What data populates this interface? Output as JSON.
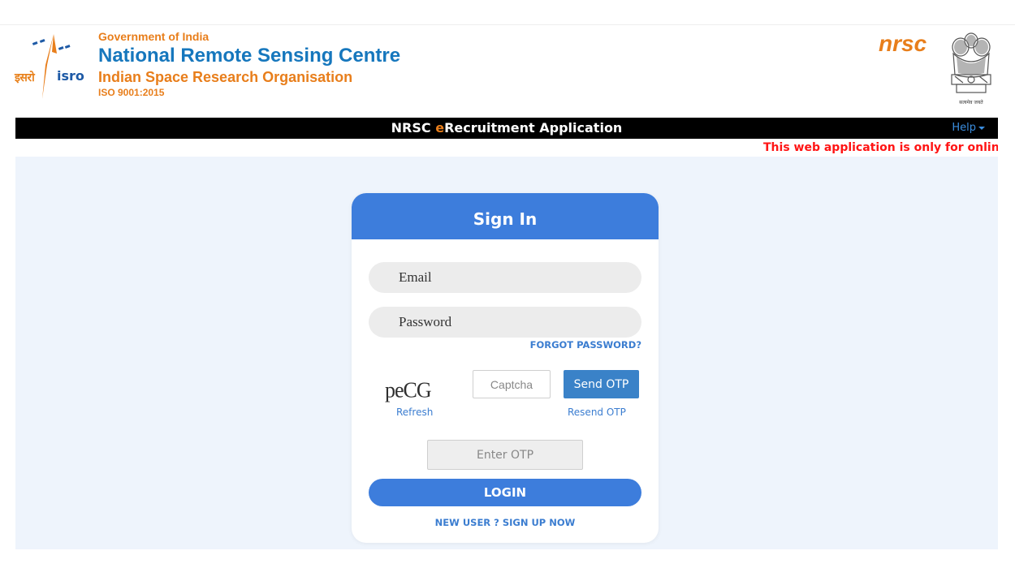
{
  "header": {
    "isro_hindi": "इसरो",
    "isro_english": "isro",
    "gov": "Government of India",
    "nrsc_name": "National Remote Sensing Centre",
    "isro_name": "Indian Space Research Organisation",
    "iso": "ISO 9001:2015",
    "nrsc_logo": "nrsc",
    "emblem_motto": "सत्यमेव जयते"
  },
  "navbar": {
    "title_prefix": "NRSC ",
    "title_e": "e",
    "title_suffix": "Recruitment Application",
    "help_label": "Help"
  },
  "marquee": {
    "text": "This web application is only for online apply"
  },
  "signin": {
    "title": "Sign In",
    "email_placeholder": "Email",
    "password_placeholder": "Password",
    "forgot_label": "FORGOT PASSWORD?",
    "captcha_text": "peCG",
    "refresh_label": "Refresh",
    "captcha_placeholder": "Captcha",
    "send_otp_label": "Send OTP",
    "resend_otp_label": "Resend OTP",
    "otp_placeholder": "Enter OTP",
    "login_label": "LOGIN",
    "signup_label": "NEW USER ? SIGN UP NOW"
  },
  "colors": {
    "brand_blue": "#3d7ddc",
    "brand_orange": "#e87e1b",
    "marquee_red": "#ff1414",
    "navbar_bg": "#000000"
  }
}
